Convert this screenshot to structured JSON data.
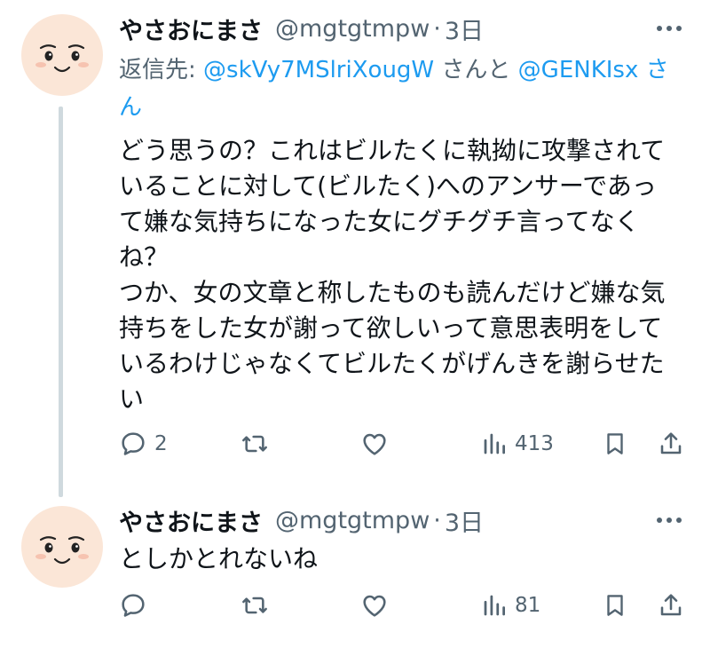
{
  "tweets": [
    {
      "author_name": "やさおにまさ",
      "handle": "@mgtgtmpw",
      "separator": "·",
      "time": "3日",
      "reply_to_prefix": "返信先: ",
      "reply_to_mention1": "@skVy7MSlriXougW",
      "reply_to_middle": " さんと ",
      "reply_to_mention2": "@GENKIsx",
      "reply_to_suffix": " さん",
      "body": "どう思うの？これはビルたくに執拗に攻撃されて\nいることに対して(ビルたく)へのアンサーであっ\nて嫌な気持ちになった女にグチグチ言ってなく\nね？\nつか、女の文章と称したものも読んだけど嫌な気\n持ちをした女が謝って欲しいって意思表明をして\nいるわけじゃなくてビルたくがげんきを謝らせた\nい",
      "reply_count": "2",
      "retweet_count": "",
      "like_count": "",
      "view_count": "413"
    },
    {
      "author_name": "やさおにまさ",
      "handle": "@mgtgtmpw",
      "separator": "·",
      "time": "3日",
      "body": "としかとれないね",
      "reply_count": "",
      "retweet_count": "",
      "like_count": "",
      "view_count": "81"
    }
  ],
  "icons": {
    "more": "more-horizontal-icon",
    "reply": "reply-icon",
    "retweet": "retweet-icon",
    "like": "heart-icon",
    "views": "views-icon",
    "bookmark": "bookmark-icon",
    "share": "share-icon"
  },
  "colors": {
    "text": "#0f1419",
    "muted": "#536471",
    "link": "#1d9bf0",
    "thread_line": "#cfd9de",
    "avatar_bg": "#fbe6d7"
  }
}
